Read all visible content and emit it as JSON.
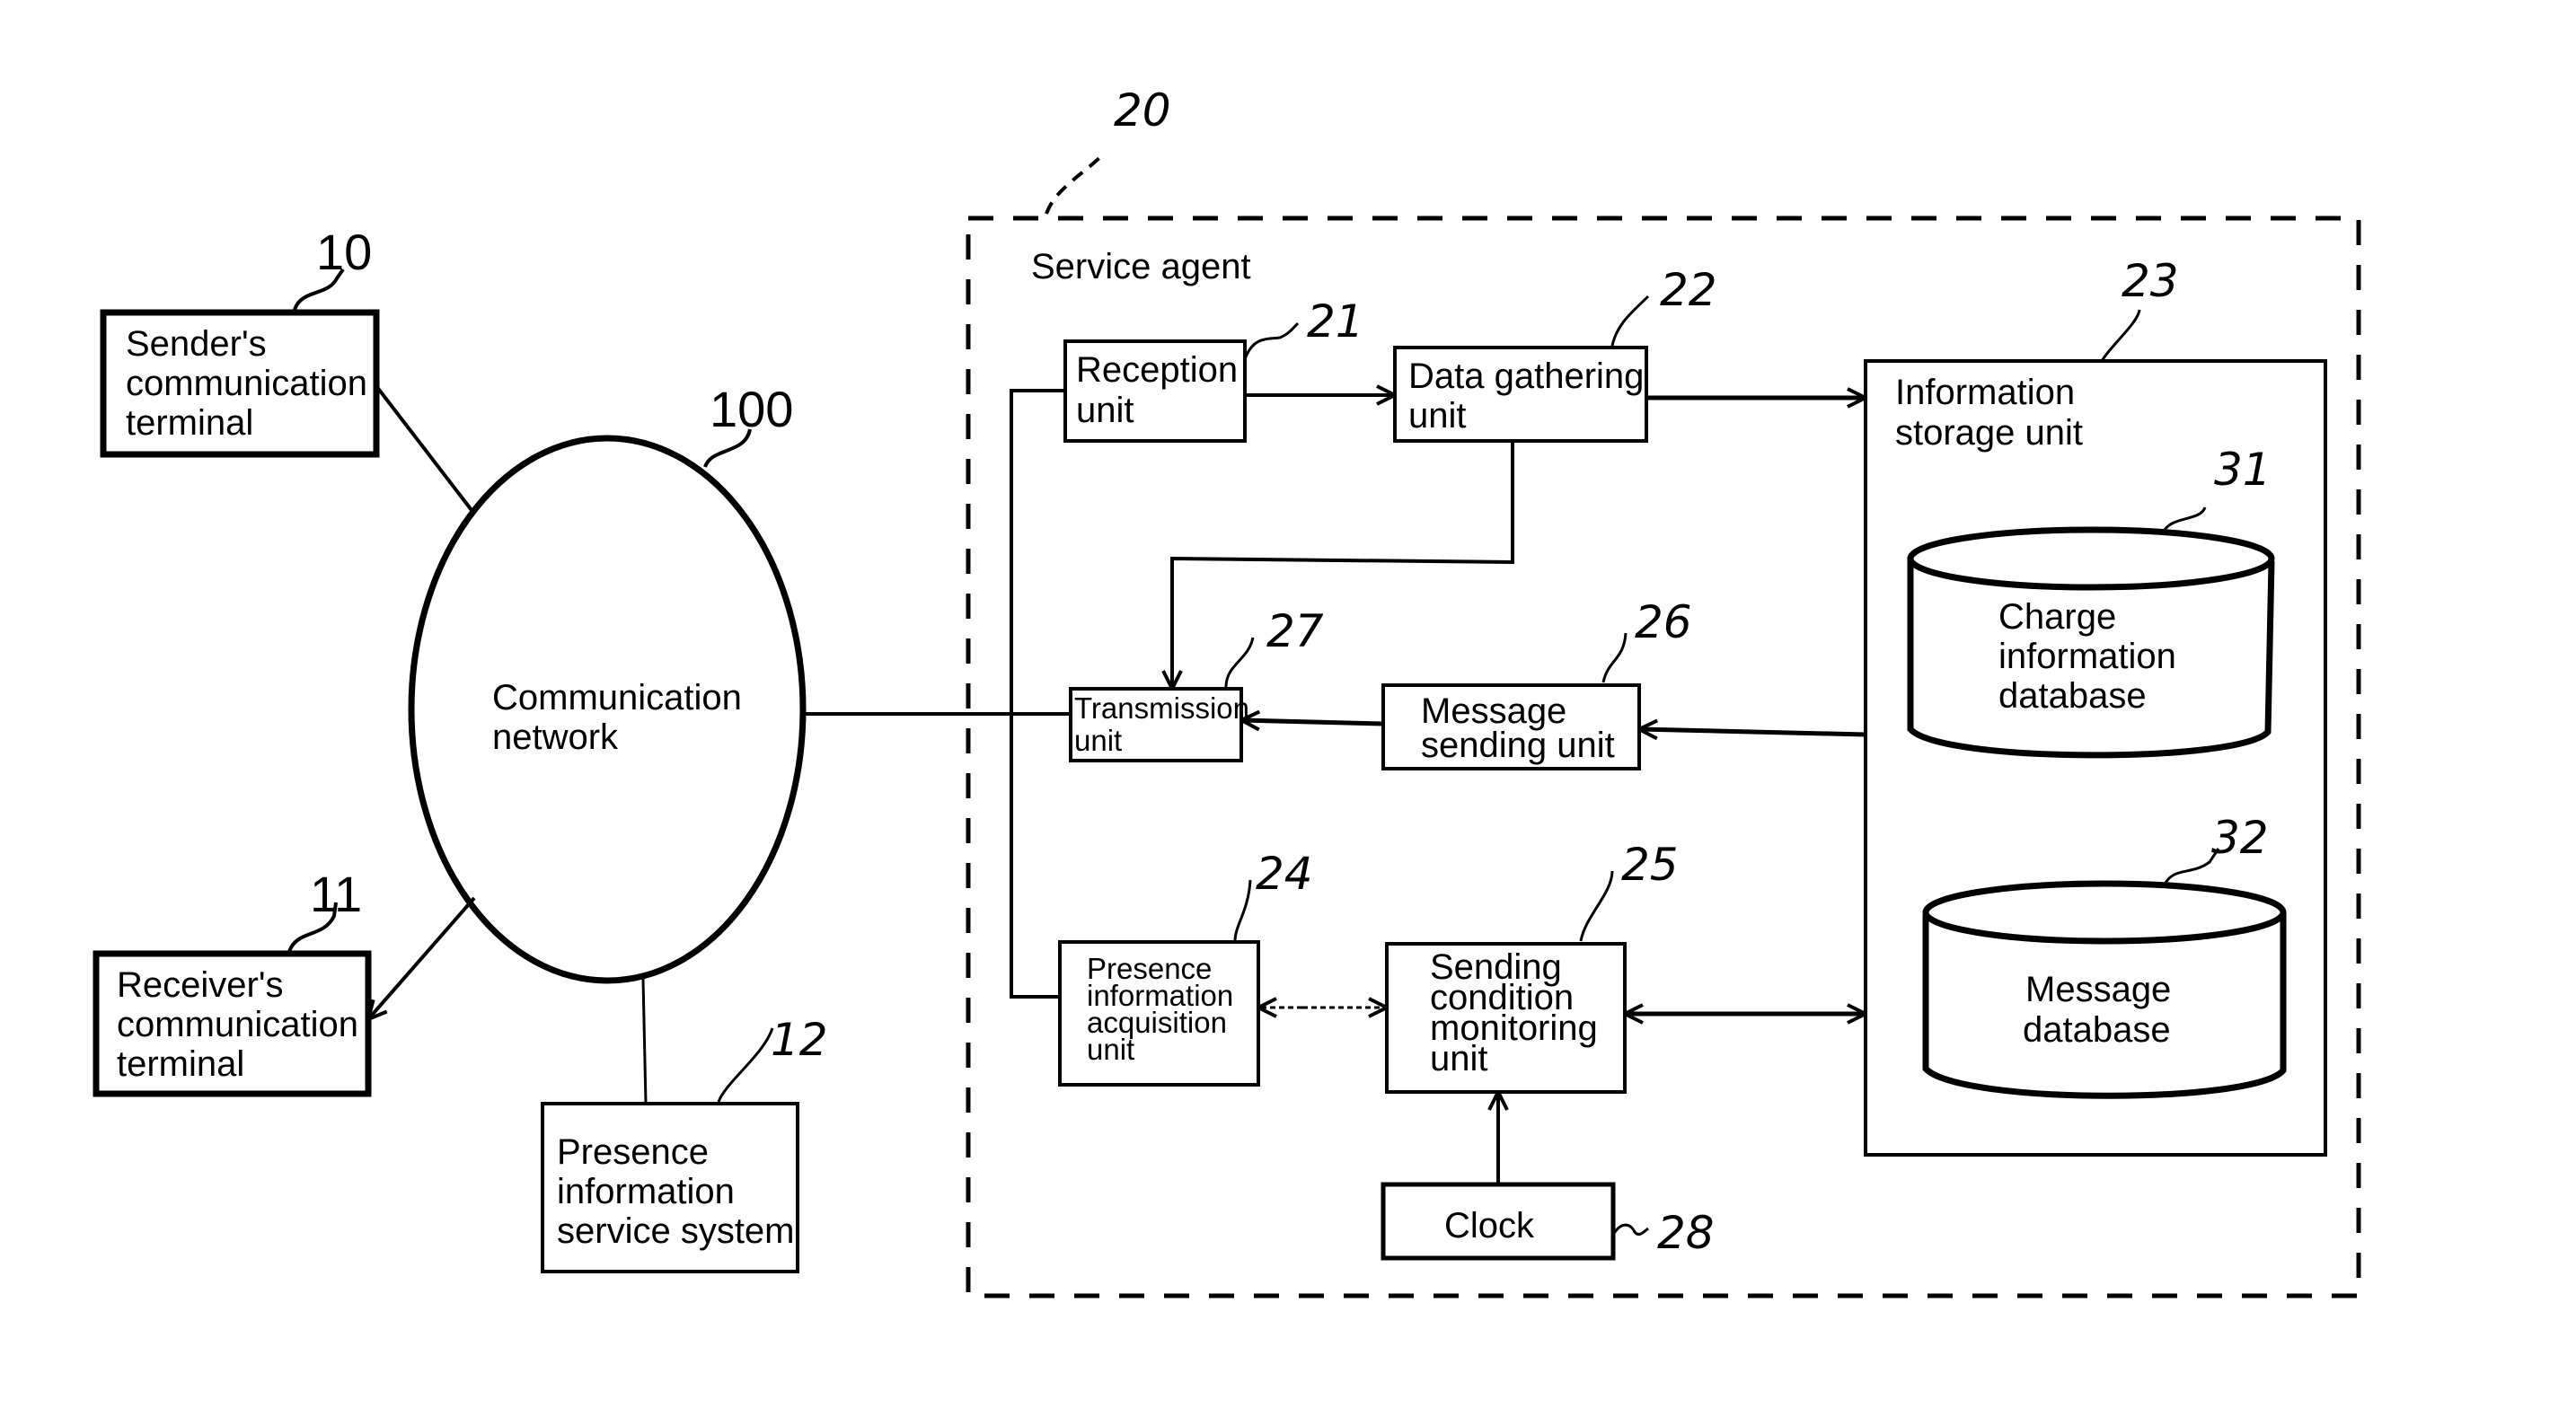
{
  "diagram": {
    "external": {
      "sender": {
        "ref": "10",
        "lines": [
          "Sender's",
          "communication",
          "terminal"
        ]
      },
      "receiver": {
        "ref": "11",
        "lines": [
          "Receiver's",
          "communication",
          "terminal"
        ]
      },
      "network": {
        "ref": "100",
        "lines": [
          "Communication",
          "network"
        ]
      },
      "presence_service": {
        "ref": "12",
        "lines": [
          "Presence",
          "information",
          "service system"
        ]
      }
    },
    "service_agent": {
      "ref": "20",
      "title": "Service agent",
      "reception": {
        "ref": "21",
        "lines": [
          "Reception",
          "unit"
        ]
      },
      "data_gathering": {
        "ref": "22",
        "lines": [
          "Data gathering",
          "unit"
        ]
      },
      "info_storage": {
        "ref": "23",
        "lines": [
          "Information",
          "storage unit"
        ]
      },
      "presence_acq": {
        "ref": "24",
        "lines": [
          "Presence",
          "information",
          "acquisition",
          "unit"
        ]
      },
      "sending_condition": {
        "ref": "25",
        "lines": [
          "Sending",
          "condition",
          "monitoring",
          "unit"
        ]
      },
      "message_sending": {
        "ref": "26",
        "lines": [
          "Message",
          "sending unit"
        ]
      },
      "transmission": {
        "ref": "27",
        "lines": [
          "Transmission",
          "unit"
        ]
      },
      "clock": {
        "ref": "28",
        "lines": [
          "Clock"
        ]
      },
      "charge_db": {
        "ref": "31",
        "lines": [
          "Charge",
          "information",
          "database"
        ]
      },
      "message_db": {
        "ref": "32",
        "lines": [
          "Message",
          "database"
        ]
      }
    }
  }
}
